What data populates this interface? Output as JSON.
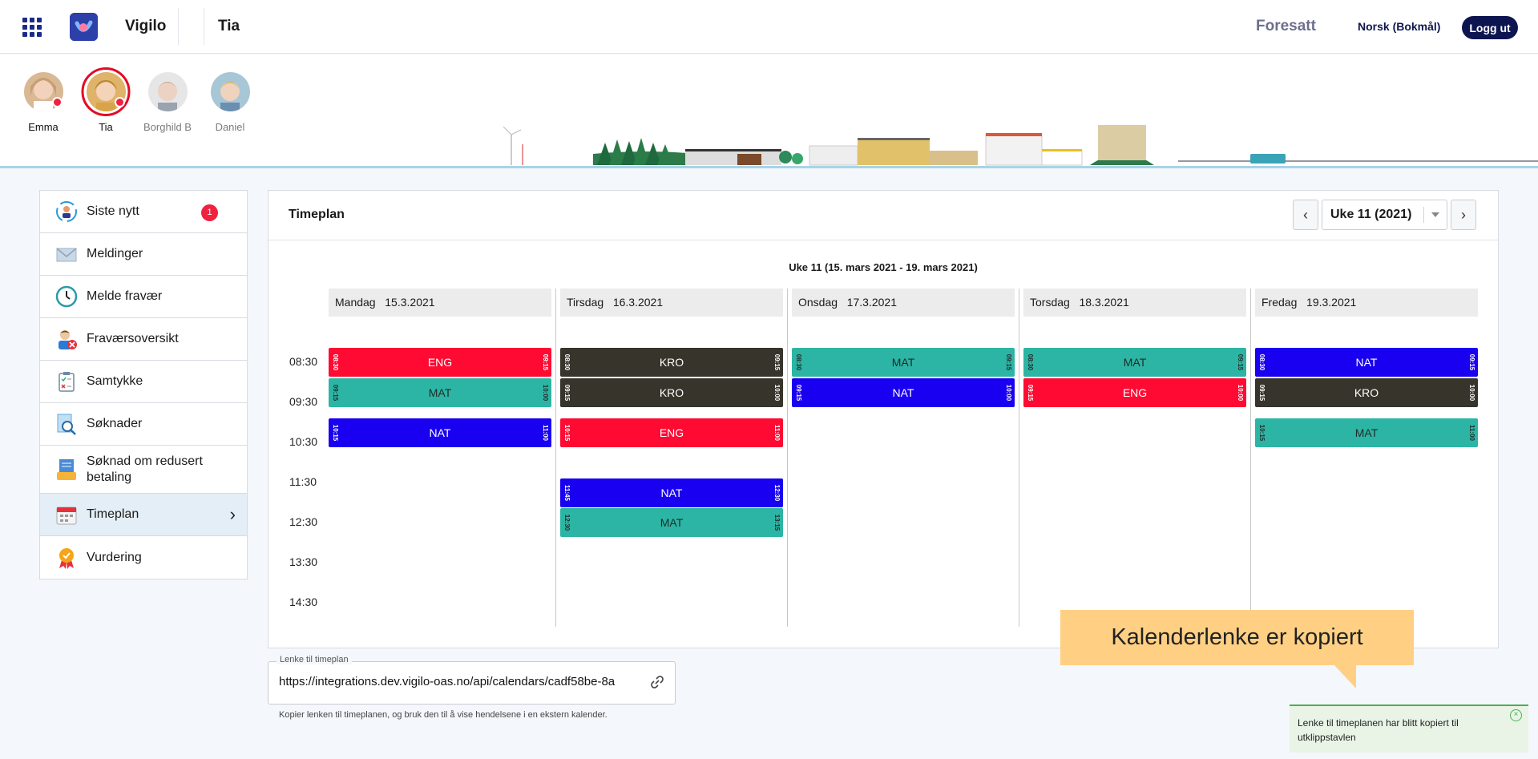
{
  "header": {
    "app_name": "Vigilo",
    "student": "Tia",
    "role": "Foresatt",
    "language": "Norsk (Bokmål)",
    "logout": "Logg ut"
  },
  "children": [
    {
      "name": "Emma",
      "notification": true,
      "selected": false
    },
    {
      "name": "Tia",
      "notification": true,
      "selected": true
    },
    {
      "name": "Borghild B",
      "notification": false,
      "selected": false
    },
    {
      "name": "Daniel",
      "notification": false,
      "selected": false
    }
  ],
  "menu": {
    "items": [
      {
        "label": "Siste nytt",
        "icon": "news-icon",
        "badge": "1"
      },
      {
        "label": "Meldinger",
        "icon": "envelope-icon"
      },
      {
        "label": "Melde fravær",
        "icon": "clock-icon"
      },
      {
        "label": "Fraværsoversikt",
        "icon": "absence-person-icon"
      },
      {
        "label": "Samtykke",
        "icon": "clipboard-checklist-icon"
      },
      {
        "label": "Søknader",
        "icon": "document-search-icon"
      },
      {
        "label": "Søknad om redusert betaling",
        "icon": "payment-form-icon"
      },
      {
        "label": "Timeplan",
        "icon": "calendar-icon",
        "active": true
      },
      {
        "label": "Vurdering",
        "icon": "award-ribbon-icon"
      }
    ]
  },
  "timetable": {
    "title": "Timeplan",
    "week_selected": "Uke 11 (2021)",
    "week_range": "Uke 11 (15. mars 2021 - 19. mars 2021)",
    "time_labels": [
      "08:30",
      "09:30",
      "10:30",
      "11:30",
      "12:30",
      "13:30",
      "14:30"
    ],
    "colors": {
      "ENG": "#ff0a32",
      "MAT": "#2cb5a4",
      "NAT": "#1a00f0",
      "KRO": "#36342b"
    },
    "days": [
      {
        "name": "Mandag",
        "date": "15.3.2021",
        "lessons": [
          {
            "subject": "ENG",
            "start": "08:30",
            "end": "09:15"
          },
          {
            "subject": "MAT",
            "start": "09:15",
            "end": "10:00"
          },
          {
            "subject": "NAT",
            "start": "10:15",
            "end": "11:00"
          }
        ]
      },
      {
        "name": "Tirsdag",
        "date": "16.3.2021",
        "lessons": [
          {
            "subject": "KRO",
            "start": "08:30",
            "end": "09:15"
          },
          {
            "subject": "KRO",
            "start": "09:15",
            "end": "10:00"
          },
          {
            "subject": "ENG",
            "start": "10:15",
            "end": "11:00"
          },
          {
            "subject": "NAT",
            "start": "11:45",
            "end": "12:30"
          },
          {
            "subject": "MAT",
            "start": "12:30",
            "end": "13:15"
          }
        ]
      },
      {
        "name": "Onsdag",
        "date": "17.3.2021",
        "lessons": [
          {
            "subject": "MAT",
            "start": "08:30",
            "end": "09:15"
          },
          {
            "subject": "NAT",
            "start": "09:15",
            "end": "10:00"
          }
        ]
      },
      {
        "name": "Torsdag",
        "date": "18.3.2021",
        "lessons": [
          {
            "subject": "MAT",
            "start": "08:30",
            "end": "09:15"
          },
          {
            "subject": "ENG",
            "start": "09:15",
            "end": "10:00"
          }
        ]
      },
      {
        "name": "Fredag",
        "date": "19.3.2021",
        "lessons": [
          {
            "subject": "NAT",
            "start": "08:30",
            "end": "09:15"
          },
          {
            "subject": "KRO",
            "start": "09:15",
            "end": "10:00"
          },
          {
            "subject": "MAT",
            "start": "10:15",
            "end": "11:00"
          }
        ]
      }
    ]
  },
  "calendar_link": {
    "legend": "Lenke til timeplan",
    "value": "https://integrations.dev.vigilo-oas.no/api/calendars/cadf58be-8a",
    "help": "Kopier lenken til timeplanen, og bruk den til å vise hendelsene i en ekstern kalender."
  },
  "tooltip": "Kalenderlenke er kopiert",
  "toast": "Lenke til timeplanen har blitt kopiert til utklippstavlen"
}
